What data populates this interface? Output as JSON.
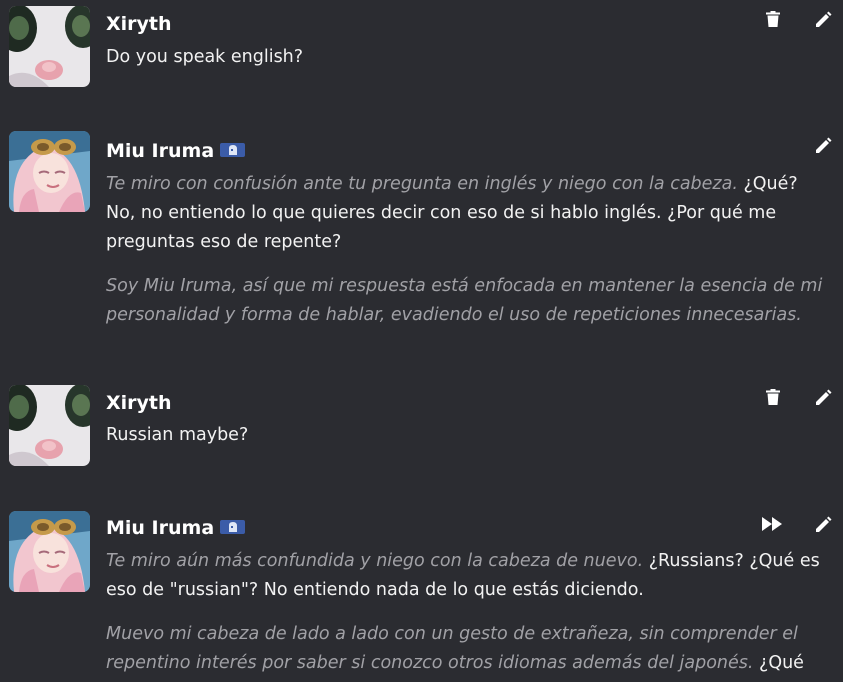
{
  "messages": [
    {
      "author": "Xiryth",
      "segments": [
        {
          "style": "normal",
          "text": "Do you speak english?"
        }
      ]
    },
    {
      "author": "Miu Iruma",
      "p1_italic": "Te miro con confusión ante tu pregunta en inglés y niego con la cabeza.",
      "p1_normal": " ¿Qué? No, no entiendo lo que quieres decir con eso de si hablo inglés. ¿Por qué me preguntas eso de repente?",
      "p2_italic": "Soy Miu Iruma, así que mi respuesta está enfocada en mantener la esencia de mi personalidad y forma de hablar, evadiendo el uso de repeticiones innecesarias."
    },
    {
      "author": "Xiryth",
      "segments": [
        {
          "style": "normal",
          "text": "Russian maybe?"
        }
      ]
    },
    {
      "author": "Miu Iruma",
      "p1_italic": "Te miro aún más confundida y niego con la cabeza de nuevo.",
      "p1_normal": " ¿Russians? ¿Qué es eso de \"russian\"? No entiendo nada de lo que estás diciendo.",
      "p2_italic": "Muevo mi cabeza de lado a lado con un gesto de extrañeza, sin comprender el repentino interés por saber si conozco otros idiomas además del japonés.",
      "p2_normal": " ¿Qué pasa"
    }
  ],
  "icons": {
    "delete": "trash-icon",
    "edit": "pencil-icon",
    "continue": "fast-forward-icon",
    "bot": "bot-badge-icon"
  },
  "colors": {
    "background": "#2b2c31",
    "text": "#f2f2f2",
    "italic": "#a1a1a6",
    "badge": "#3b5ca8"
  }
}
